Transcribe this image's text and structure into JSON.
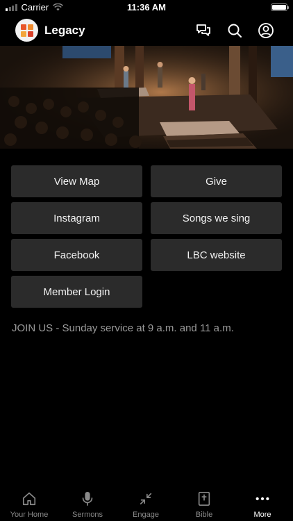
{
  "status_bar": {
    "carrier": "Carrier",
    "time": "11:36 AM"
  },
  "header": {
    "title": "Legacy",
    "icons": [
      "chat-icon",
      "search-icon",
      "profile-icon"
    ]
  },
  "hero": {
    "image": "church-stage-worship-photo"
  },
  "buttons": [
    {
      "label": "View Map"
    },
    {
      "label": "Give"
    },
    {
      "label": "Instagram"
    },
    {
      "label": "Songs we sing"
    },
    {
      "label": "Facebook"
    },
    {
      "label": "LBC website"
    },
    {
      "label": "Member Login"
    }
  ],
  "announcement": "JOIN US - Sunday service at 9 a.m. and 11 a.m.",
  "tabs": [
    {
      "label": "Your Home",
      "icon": "home-icon"
    },
    {
      "label": "Sermons",
      "icon": "microphone-icon"
    },
    {
      "label": "Engage",
      "icon": "collapse-arrows-icon"
    },
    {
      "label": "Bible",
      "icon": "bible-icon"
    },
    {
      "label": "More",
      "icon": "more-dots-icon",
      "active": true
    }
  ],
  "colors": {
    "background": "#000000",
    "button": "#2b2b2b",
    "muted_text": "#9a9a9a"
  }
}
